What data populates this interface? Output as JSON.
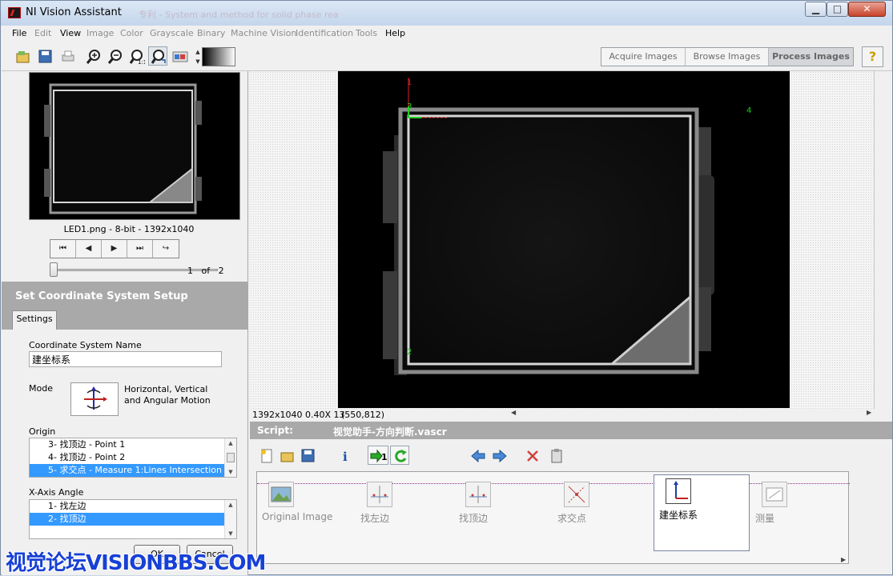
{
  "window": {
    "title": "NI Vision Assistant",
    "ghost_text": "专利 - System and method for solid phase rea",
    "minimize": "▁",
    "maximize": "□",
    "close": "✕"
  },
  "menu": {
    "items": [
      {
        "label": "File",
        "enabled": true
      },
      {
        "label": "Edit",
        "enabled": false
      },
      {
        "label": "View",
        "enabled": true
      },
      {
        "label": "Image",
        "enabled": false
      },
      {
        "label": "Color",
        "enabled": false
      },
      {
        "label": "Grayscale",
        "enabled": false
      },
      {
        "label": "Binary",
        "enabled": false
      },
      {
        "label": "Machine Vision",
        "enabled": false
      },
      {
        "label": "Identification",
        "enabled": false
      },
      {
        "label": "Tools",
        "enabled": false
      },
      {
        "label": "Help",
        "enabled": true
      }
    ]
  },
  "toolbar": {
    "icons": [
      "open-image-icon",
      "save-image-icon",
      "print-icon",
      "zoom-in-icon",
      "zoom-out-icon",
      "zoom-1to1-icon",
      "zoom-fit-icon",
      "palette-icon"
    ],
    "mode_tabs": [
      {
        "label": "Acquire Images",
        "active": false
      },
      {
        "label": "Browse Images",
        "active": false
      },
      {
        "label": "Process Images",
        "active": true
      }
    ],
    "help": "?"
  },
  "thumbnail": {
    "caption": "LED1.png - 8-bit - 1392x1040",
    "nav": [
      "⏮",
      "◀",
      "▶",
      "⏭",
      "↪"
    ],
    "page_current": "1",
    "page_of": "of",
    "page_total": "2"
  },
  "setup": {
    "title": "Set Coordinate System Setup",
    "tab": "Settings",
    "coord_name_label": "Coordinate System Name",
    "coord_name_value": "建坐标系",
    "mode_label": "Mode",
    "mode_line1": "Horizontal, Vertical",
    "mode_line2": "and Angular Motion",
    "origin_label": "Origin",
    "origin_items": [
      {
        "text": "3- 找顶边 - Point 1",
        "selected": false
      },
      {
        "text": "4- 找顶边 - Point 2",
        "selected": false
      },
      {
        "text": "5- 求交点 - Measure 1:Lines Intersection",
        "selected": true
      }
    ],
    "xaxis_label": "X-Axis Angle",
    "xaxis_items": [
      {
        "text": "1- 找左边",
        "selected": false
      },
      {
        "text": "2- 找顶边",
        "selected": true
      }
    ],
    "ok": "OK",
    "cancel": "Cancel"
  },
  "viewer": {
    "status_size": "1392x1040 0.40X 13",
    "status_coord": "(550,812)",
    "markers": [
      "1",
      "3",
      "4",
      "2"
    ],
    "colors": {
      "axis_red": "#e02020",
      "axis_green": "#20d020"
    }
  },
  "script": {
    "label": "Script:",
    "filename": "视觉助手-方向判断.vascr",
    "tools": [
      "new-script-icon",
      "open-script-icon",
      "save-script-icon",
      "info-icon",
      "run-once-icon",
      "run-loop-icon",
      "back-icon",
      "forward-icon",
      "delete-icon",
      "clipboard-icon"
    ],
    "run_count": "1",
    "steps": [
      {
        "label": "Original Image",
        "icon": "original-image-icon",
        "active": false
      },
      {
        "label": "找左边",
        "icon": "find-edge-icon",
        "active": false
      },
      {
        "label": "找顶边",
        "icon": "find-edge-icon",
        "active": false
      },
      {
        "label": "求交点",
        "icon": "intersection-icon",
        "active": false
      },
      {
        "label": "建坐标系",
        "icon": "coordinate-system-icon",
        "active": true
      },
      {
        "label": "测量",
        "icon": "measure-icon",
        "active": false
      }
    ]
  },
  "watermark": "视觉论坛VISIONBBS.COM"
}
